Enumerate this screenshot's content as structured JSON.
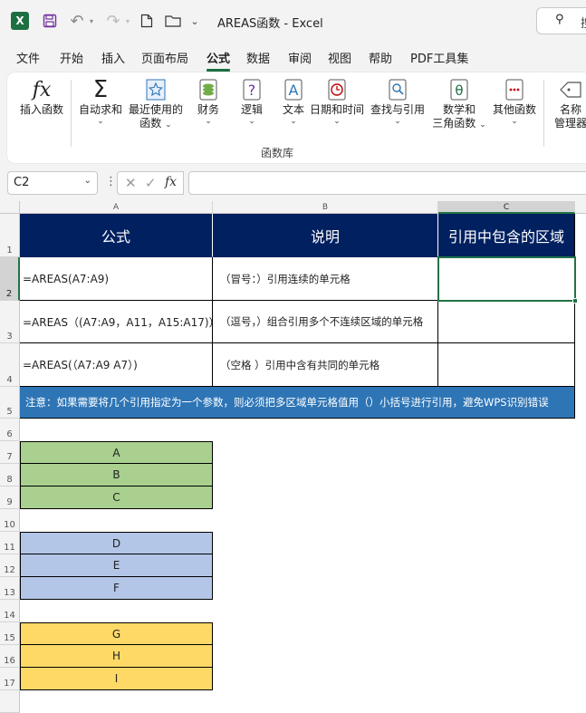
{
  "window": {
    "title": "AREAS函数  -  Excel",
    "search_text": "搜"
  },
  "menu": {
    "tabs": [
      "文件",
      "开始",
      "插入",
      "页面布局",
      "公式",
      "数据",
      "审阅",
      "视图",
      "帮助",
      "PDF工具集"
    ],
    "active": "公式"
  },
  "ribbon": {
    "insert_function": "插入函数",
    "autosum": "自动求和",
    "recent": [
      "最近使用的",
      "函数"
    ],
    "financial": "财务",
    "logical": "逻辑",
    "text": "文本",
    "datetime": "日期和时间",
    "lookup": "查找与引用",
    "math": [
      "数学和",
      "三角函数"
    ],
    "more": "其他函数",
    "name_manager": [
      "名称",
      "管理器"
    ],
    "group_label": "函数库"
  },
  "formula_bar": {
    "name_box": "C2",
    "formula": ""
  },
  "columns": [
    "A",
    "B",
    "C"
  ],
  "rows": [
    "1",
    "2",
    "3",
    "4",
    "5",
    "6",
    "7",
    "8",
    "9",
    "10",
    "11",
    "12",
    "13",
    "14",
    "15",
    "16",
    "17"
  ],
  "table": {
    "headers": [
      "公式",
      "说明",
      "引用中包含的区域"
    ],
    "rows": [
      {
        "formula": "=AREAS(A7:A9)",
        "desc": "（冒号：）引用连续的单元格",
        "result": ""
      },
      {
        "formula": "=AREAS（(A7:A9，A11，A15:A17)）",
        "desc": "（逗号，）组合引用多个不连续区域的单元格",
        "result": ""
      },
      {
        "formula": "=AREAS(（A7:A9 A7）)",
        "desc": "（空格 ）引用中含有共同的单元格",
        "result": ""
      }
    ],
    "note": "注意：如果需要将几个引用指定为一个参数，则必须把多区域单元格值用（）小括号进行引用，避免WPS识别错误"
  },
  "lists": {
    "green": [
      "A",
      "B",
      "C"
    ],
    "blue": [
      "D",
      "E",
      "F"
    ],
    "yellow": [
      "G",
      "H",
      "I"
    ]
  },
  "colors": {
    "header_bg": "#002060",
    "note_bg": "#2E75B6",
    "green": "#A9D08E",
    "blue": "#B4C6E7",
    "yellow": "#FFD966",
    "excel_green": "#217346"
  }
}
